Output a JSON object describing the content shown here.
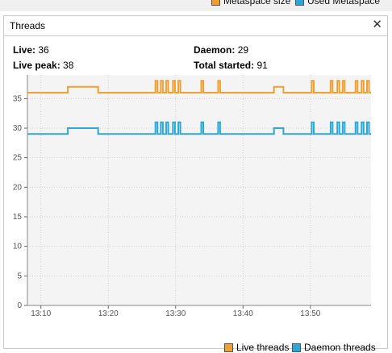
{
  "top_legend": [
    {
      "label": "Metaspace size",
      "color": "#f0a030"
    },
    {
      "label": "Used Metaspace",
      "color": "#2aa8d8"
    }
  ],
  "panel": {
    "title": "Threads",
    "close_icon": "close-icon"
  },
  "stats": {
    "live_label": "Live:",
    "live_value": "36",
    "live_peak_label": "Live peak:",
    "live_peak_value": "38",
    "daemon_label": "Daemon:",
    "daemon_value": "29",
    "total_started_label": "Total started:",
    "total_started_value": "91"
  },
  "chart_data": {
    "type": "line",
    "x_tick_labels": [
      "13:10",
      "13:20",
      "13:30",
      "13:40",
      "13:50"
    ],
    "y_tick_labels": [
      "0",
      "5",
      "10",
      "15",
      "20",
      "25",
      "30",
      "35"
    ],
    "ylim": [
      0,
      39
    ],
    "xlim_minutes": [
      8,
      59
    ],
    "grid": true,
    "legend_placement": "bottom-right",
    "series": [
      {
        "name": "Live threads",
        "color": "#f0a030",
        "points": [
          [
            8,
            36
          ],
          [
            14,
            36
          ],
          [
            14,
            37
          ],
          [
            18.5,
            37
          ],
          [
            18.5,
            36
          ],
          [
            27,
            36
          ],
          [
            27,
            38
          ],
          [
            27.3,
            38
          ],
          [
            27.3,
            36
          ],
          [
            27.8,
            36
          ],
          [
            27.8,
            38
          ],
          [
            28.1,
            38
          ],
          [
            28.1,
            36
          ],
          [
            28.6,
            36
          ],
          [
            28.6,
            38
          ],
          [
            28.9,
            38
          ],
          [
            28.9,
            36
          ],
          [
            29.6,
            36
          ],
          [
            29.6,
            38
          ],
          [
            29.9,
            38
          ],
          [
            29.9,
            36
          ],
          [
            30.4,
            36
          ],
          [
            30.4,
            38
          ],
          [
            30.7,
            38
          ],
          [
            30.7,
            36
          ],
          [
            33.8,
            36
          ],
          [
            33.8,
            38
          ],
          [
            34.1,
            38
          ],
          [
            34.1,
            36
          ],
          [
            36.3,
            36
          ],
          [
            36.3,
            38
          ],
          [
            36.6,
            38
          ],
          [
            36.6,
            36
          ],
          [
            44.6,
            36
          ],
          [
            44.6,
            37
          ],
          [
            46,
            37
          ],
          [
            46,
            36
          ],
          [
            50.2,
            36
          ],
          [
            50.2,
            38
          ],
          [
            50.5,
            38
          ],
          [
            50.5,
            36
          ],
          [
            53,
            36
          ],
          [
            53,
            38
          ],
          [
            53.3,
            38
          ],
          [
            53.3,
            36
          ],
          [
            54,
            36
          ],
          [
            54,
            38
          ],
          [
            54.3,
            38
          ],
          [
            54.3,
            36
          ],
          [
            54.8,
            36
          ],
          [
            54.8,
            38
          ],
          [
            55.1,
            38
          ],
          [
            55.1,
            36
          ],
          [
            56.7,
            36
          ],
          [
            56.7,
            38
          ],
          [
            57,
            38
          ],
          [
            57,
            36
          ],
          [
            57.6,
            36
          ],
          [
            57.6,
            38
          ],
          [
            57.9,
            38
          ],
          [
            57.9,
            36
          ],
          [
            58.4,
            36
          ],
          [
            58.4,
            38
          ],
          [
            58.7,
            38
          ],
          [
            58.7,
            36
          ],
          [
            59,
            36
          ]
        ]
      },
      {
        "name": "Daemon threads",
        "color": "#2aa8d8",
        "points": [
          [
            8,
            29
          ],
          [
            14,
            29
          ],
          [
            14,
            30
          ],
          [
            18.5,
            30
          ],
          [
            18.5,
            29
          ],
          [
            27,
            29
          ],
          [
            27,
            31
          ],
          [
            27.3,
            31
          ],
          [
            27.3,
            29
          ],
          [
            27.8,
            29
          ],
          [
            27.8,
            31
          ],
          [
            28.1,
            31
          ],
          [
            28.1,
            29
          ],
          [
            28.6,
            29
          ],
          [
            28.6,
            31
          ],
          [
            28.9,
            31
          ],
          [
            28.9,
            29
          ],
          [
            29.6,
            29
          ],
          [
            29.6,
            31
          ],
          [
            29.9,
            31
          ],
          [
            29.9,
            29
          ],
          [
            30.4,
            29
          ],
          [
            30.4,
            31
          ],
          [
            30.7,
            31
          ],
          [
            30.7,
            29
          ],
          [
            33.8,
            29
          ],
          [
            33.8,
            31
          ],
          [
            34.1,
            31
          ],
          [
            34.1,
            29
          ],
          [
            36.3,
            29
          ],
          [
            36.3,
            31
          ],
          [
            36.6,
            31
          ],
          [
            36.6,
            29
          ],
          [
            44.6,
            29
          ],
          [
            44.6,
            30
          ],
          [
            46,
            30
          ],
          [
            46,
            29
          ],
          [
            50.2,
            29
          ],
          [
            50.2,
            31
          ],
          [
            50.5,
            31
          ],
          [
            50.5,
            29
          ],
          [
            53,
            29
          ],
          [
            53,
            31
          ],
          [
            53.3,
            31
          ],
          [
            53.3,
            29
          ],
          [
            54,
            29
          ],
          [
            54,
            31
          ],
          [
            54.3,
            31
          ],
          [
            54.3,
            29
          ],
          [
            54.8,
            29
          ],
          [
            54.8,
            31
          ],
          [
            55.1,
            31
          ],
          [
            55.1,
            29
          ],
          [
            56.7,
            29
          ],
          [
            56.7,
            31
          ],
          [
            57,
            31
          ],
          [
            57,
            29
          ],
          [
            57.6,
            29
          ],
          [
            57.6,
            31
          ],
          [
            57.9,
            31
          ],
          [
            57.9,
            29
          ],
          [
            58.4,
            29
          ],
          [
            58.4,
            31
          ],
          [
            58.7,
            31
          ],
          [
            58.7,
            29
          ],
          [
            59,
            29
          ]
        ]
      }
    ]
  }
}
